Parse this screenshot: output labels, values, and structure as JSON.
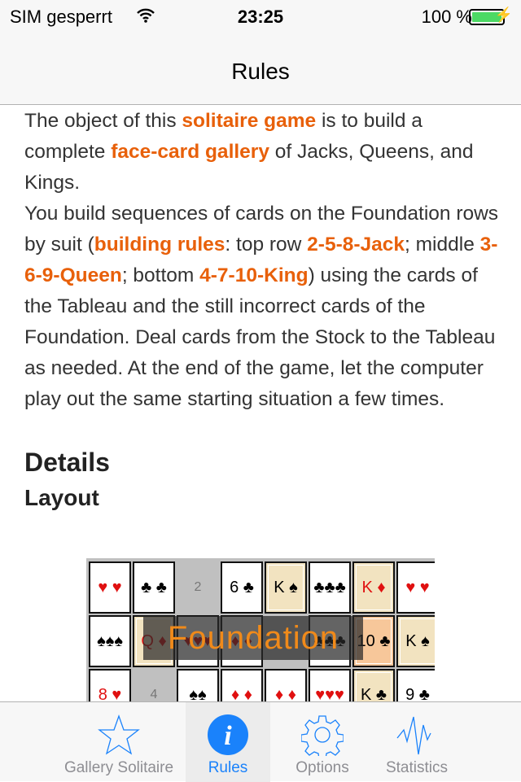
{
  "status": {
    "carrier": "SIM gesperrt",
    "time": "23:25",
    "battery": "100 %",
    "battery_level": 100
  },
  "nav": {
    "title": "Rules"
  },
  "content": {
    "p1": [
      {
        "t": "The object of this "
      },
      {
        "t": "solitaire game",
        "h": true
      },
      {
        "t": " is to build a complete "
      },
      {
        "t": "face-card gallery",
        "h": true
      },
      {
        "t": " of Jacks, Queens, and Kings."
      }
    ],
    "p2": [
      {
        "t": "You build sequences of cards on the Foundation rows by suit ("
      },
      {
        "t": "building rules",
        "h": true
      },
      {
        "t": ": top row "
      },
      {
        "t": "2-5-8-Jack",
        "h": true
      },
      {
        "t": "; middle "
      },
      {
        "t": "3-6-9-Queen",
        "h": true
      },
      {
        "t": "; bottom "
      },
      {
        "t": "4-7-10-King",
        "h": true
      },
      {
        "t": ") using the cards of the Tableau and the still incorrect cards of the Foundation. Deal cards from the Stock to the Tableau as needed. At the end of the game, let the computer play out the same starting situation a few times."
      }
    ],
    "details_heading": "Details",
    "layout_heading": "Layout",
    "highlight_color": "#e8600a"
  },
  "board": {
    "overlay_label": "Foundation",
    "cards": [
      {
        "label": "♥ ♥",
        "color": "red"
      },
      {
        "label": "♣ ♣",
        "color": "blk"
      },
      {
        "label": "2",
        "kind": "empty"
      },
      {
        "label": "6 ♣",
        "color": "blk"
      },
      {
        "label": "K ♠",
        "color": "blk",
        "kind": "face"
      },
      {
        "label": "♣♣♣",
        "color": "blk"
      },
      {
        "label": "K ♦",
        "color": "red",
        "kind": "face"
      },
      {
        "label": "♥ ♥",
        "color": "red"
      },
      {
        "label": "♠♠♠",
        "color": "blk"
      },
      {
        "label": "Q ♦",
        "color": "red",
        "kind": "face"
      },
      {
        "label": "♥♥♥",
        "color": "red"
      },
      {
        "label": "♦ ♦",
        "color": "red"
      },
      {
        "label": "",
        "kind": "empty"
      },
      {
        "label": "♣♣♣",
        "color": "blk"
      },
      {
        "label": "10 ♣",
        "color": "blk",
        "kind": "hilite"
      },
      {
        "label": "K ♠",
        "color": "blk",
        "kind": "face"
      },
      {
        "label": "8 ♥",
        "color": "red"
      },
      {
        "label": "4",
        "kind": "empty"
      },
      {
        "label": "♠♠",
        "color": "blk"
      },
      {
        "label": "♦ ♦",
        "color": "red"
      },
      {
        "label": "♦ ♦",
        "color": "red"
      },
      {
        "label": "♥♥♥",
        "color": "red"
      },
      {
        "label": "K ♣",
        "color": "blk",
        "kind": "face"
      },
      {
        "label": "9 ♣",
        "color": "blk"
      }
    ]
  },
  "tabs": [
    {
      "label": "Gallery Solitaire",
      "icon": "star-icon"
    },
    {
      "label": "Rules",
      "icon": "info-icon",
      "active": true
    },
    {
      "label": "Options",
      "icon": "gear-icon"
    },
    {
      "label": "Statistics",
      "icon": "pulse-icon"
    }
  ],
  "accent": "#1a82fb"
}
